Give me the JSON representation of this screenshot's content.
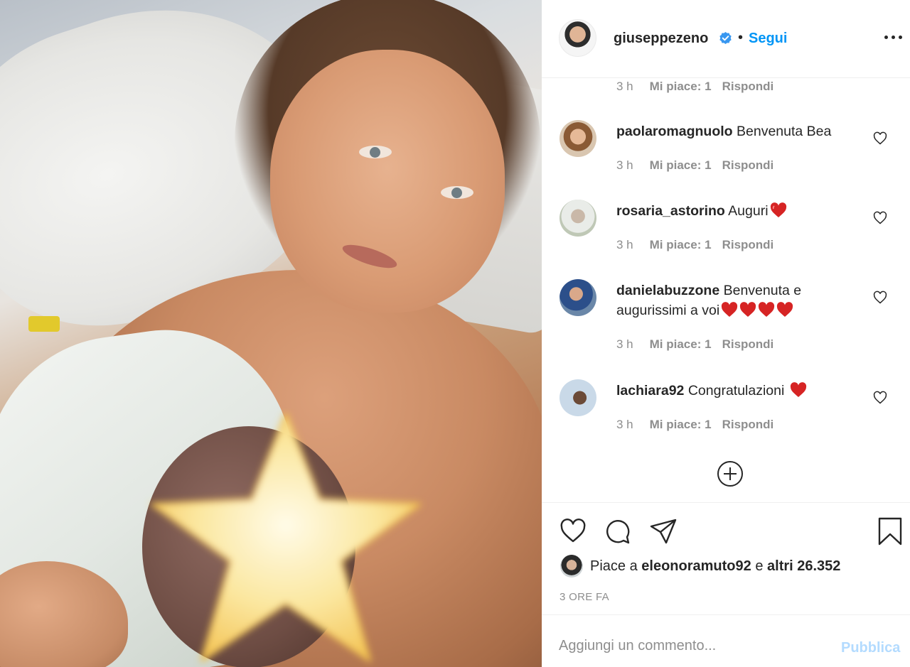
{
  "post": {
    "author": "giuseppezeno",
    "dot": "•",
    "follow_label": "Segui",
    "time_ago": "3 ORE FA",
    "liked_prefix": "Piace a",
    "liked_user": "eleonoramuto92",
    "liked_and": "e",
    "liked_others": "altri 26.352"
  },
  "comments": [
    {
      "time": "3 h",
      "likes": "Mi piace: 1",
      "reply": "Rispondi"
    },
    {
      "user": "paolaromagnuolo",
      "text": "Benvenuta Bea",
      "time": "3 h",
      "likes": "Mi piace: 1",
      "reply": "Rispondi"
    },
    {
      "user": "rosaria_astorino",
      "text": "Auguri",
      "time": "3 h",
      "likes": "Mi piace: 1",
      "reply": "Rispondi"
    },
    {
      "user": "danielabuzzone",
      "text": "Benvenuta e augurissimi a voi",
      "time": "3 h",
      "likes": "Mi piace: 1",
      "reply": "Rispondi"
    },
    {
      "user": "lachiara92",
      "text": "Congratulazioni",
      "time": "3 h",
      "likes": "Mi piace: 1",
      "reply": "Rispondi"
    }
  ],
  "composer": {
    "placeholder": "Aggiungi un commento...",
    "publish_label": "Pubblica"
  },
  "colors": {
    "link_blue": "#0095f6",
    "publish_disabled": "#b3dbff",
    "muted": "#8e8e8e",
    "emoji_heart": "#d62424"
  },
  "icons": [
    "verified-badge-icon",
    "more-options-icon",
    "heart-icon",
    "comment-icon",
    "share-icon",
    "bookmark-icon",
    "load-more-icon"
  ]
}
